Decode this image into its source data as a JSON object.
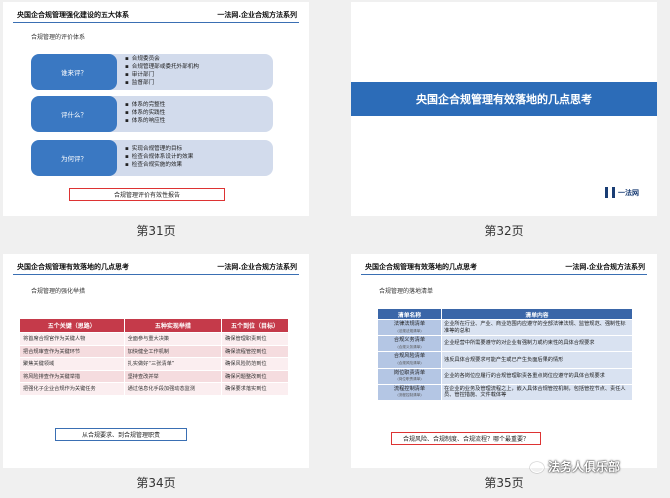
{
  "slide31": {
    "header_left": "央国企合规管理强化建设的五大体系",
    "header_right": "一法网.企业合规方法系列",
    "subtitle": "合规管理的评价体系",
    "rows": [
      {
        "label": "谁来评？",
        "items": [
          "合规委员会",
          "合规管理部或委托外部机构",
          "审计部门",
          "监督部门"
        ]
      },
      {
        "label": "评什么？",
        "items": [
          "体系的完整性",
          "体系的实践性",
          "体系的响应性"
        ]
      },
      {
        "label": "为何评？",
        "items": [
          "实现合规管理的目标",
          "检查合规体系设计的效果",
          "检查合规实施的效果"
        ]
      }
    ],
    "footer_box": "合规管理评价有效性报告",
    "page_label": "第31页"
  },
  "slide32": {
    "title": "央国企合规管理有效落地的几点思考",
    "logo_text": "一法网",
    "page_label": "第32页"
  },
  "slide34": {
    "header_left": "央国企合规管理有效落地的几点思考",
    "header_right": "一法网.企业合规方法系列",
    "subtitle": "合规管理的强化举措",
    "columns": [
      "五个关键（思路）",
      "五种实现举措",
      "五个到位（目标）"
    ],
    "rows": [
      [
        "将首席合规官作为关键人物",
        "全面参与重大决策",
        "确保管理职责到位"
      ],
      [
        "把合规审查作为关键环节",
        "加快健全工作机制",
        "确保流程管控到位"
      ],
      [
        "聚焦关键领域",
        "扎实做好“三张清单”",
        "确保风险防范到位"
      ],
      [
        "将风险排查作为关键举措",
        "坚持查改并举",
        "确保问题整改到位"
      ],
      [
        "把强化子企业合规作为关键任务",
        "通过信息化手段加强动态监测",
        "确保要求落实到位"
      ]
    ],
    "footer_box": "从合规要求、到合规管理职责",
    "page_label": "第34页"
  },
  "slide35": {
    "header_left": "央国企合规管理有效落地的几点思考",
    "header_right": "一法网.企业合规方法系列",
    "subtitle": "合规管理的落地清单",
    "columns": [
      "清单名称",
      "清单内容"
    ],
    "rows": [
      {
        "name": "法律法规清单",
        "en": "(法规法规清单)",
        "desc": "企业所在行业、产业、商业范围内应遵守的全部法律法规、监管规范、强制性标准等的总和"
      },
      {
        "name": "合规义务清单",
        "en": "(合规义务清单)",
        "desc": "企业经营中所需要遵守的对企业有强制力或约束性的具体合规要求"
      },
      {
        "name": "合规风险清单",
        "en": "(合规风险清单)",
        "desc": "违反具体合规要求可能产生或已产生负面后果的情形"
      },
      {
        "name": "岗位职责清单",
        "en": "(岗位职责清单)",
        "desc": "企业的各岗位应履行的合规管理职责各重点岗位应遵守的具体合规要求"
      },
      {
        "name": "流程控制清单",
        "en": "(流程控制清单)",
        "desc": "在企业的业务及管理流程之上，嵌入具体合规管控机制，包括管控节点、责任人员、管控措施、文件载体等"
      }
    ],
    "footer_box": "合规风险、合规制度、合规流程？哪个最重要？",
    "page_label": "第35页"
  },
  "watermark": "法务人俱乐部"
}
